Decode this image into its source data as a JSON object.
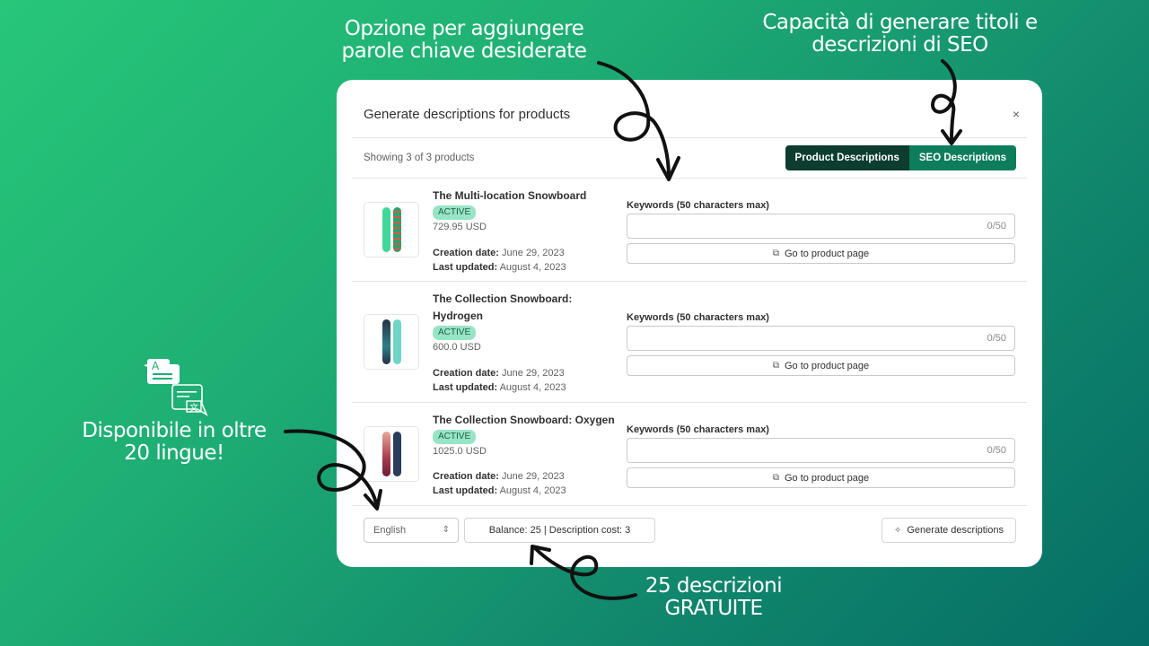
{
  "callouts": {
    "keywords": "Opzione per aggiungere parole chiave desiderate",
    "seo": "Capacità di generare titoli e descrizioni di SEO",
    "languages": "Disponibile in oltre 20 lingue!",
    "free": "25 descrizioni GRATUITE"
  },
  "modal": {
    "title": "Generate descriptions for products",
    "close_icon": "×",
    "showing": "Showing 3 of 3 products",
    "tabs": [
      {
        "label": "Product Descriptions",
        "selected": false
      },
      {
        "label": "SEO Descriptions",
        "selected": true
      }
    ],
    "products": [
      {
        "name": "The Multi-location Snowboard",
        "status": "ACTIVE",
        "price": "729.95 USD",
        "creation_label": "Creation date:",
        "creation_date": "June 29, 2023",
        "updated_label": "Last updated:",
        "updated_date": "August 4, 2023",
        "keywords_label": "Keywords (50 characters max)",
        "keywords_value": "",
        "keywords_count": "0/50",
        "go_label": "Go to product page"
      },
      {
        "name": "The Collection Snowboard: Hydrogen",
        "status": "ACTIVE",
        "price": "600.0 USD",
        "creation_label": "Creation date:",
        "creation_date": "June 29, 2023",
        "updated_label": "Last updated:",
        "updated_date": "August 4, 2023",
        "keywords_label": "Keywords (50 characters max)",
        "keywords_value": "",
        "keywords_count": "0/50",
        "go_label": "Go to product page"
      },
      {
        "name": "The Collection Snowboard: Oxygen",
        "status": "ACTIVE",
        "price": "1025.0 USD",
        "creation_label": "Creation date:",
        "creation_date": "June 29, 2023",
        "updated_label": "Last updated:",
        "updated_date": "August 4, 2023",
        "keywords_label": "Keywords (50 characters max)",
        "keywords_value": "",
        "keywords_count": "0/50",
        "go_label": "Go to product page"
      }
    ],
    "footer": {
      "language": "English",
      "balance": "Balance: 25 | Description cost: 3",
      "generate_label": "Generate descriptions"
    }
  },
  "colors": {
    "tab_dark": "#0c3d2f",
    "tab_selected": "#0d7d5c",
    "badge_bg": "#98e4c6",
    "background_start": "#27c679",
    "background_end": "#056d66"
  }
}
